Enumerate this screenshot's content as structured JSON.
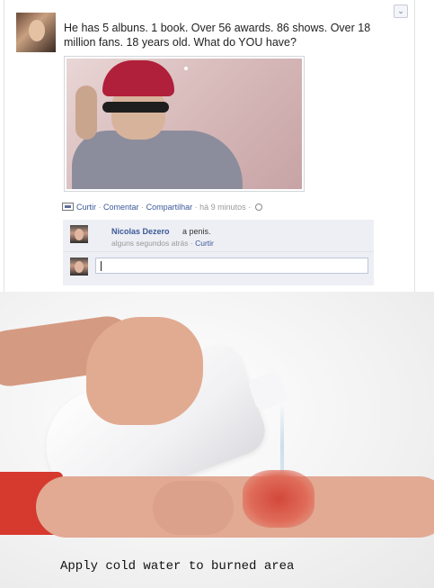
{
  "post": {
    "text": "He has 5 albuns. 1 book. Over 56 awards. 86 shows. Over 18 million fans. 18 years old. What do YOU have?",
    "actions": {
      "like": "Curtir",
      "comment": "Comentar",
      "share": "Compartilhar",
      "time": "há 9 minutos"
    }
  },
  "comment": {
    "author": "Nicolas Dezero",
    "text": "a penis.",
    "time": "alguns segundos atrás",
    "like": "Curtir"
  },
  "caption": "Apply cold water to burned area",
  "icons": {
    "chevron": "chevron-down-icon",
    "like": "like-icon",
    "privacy": "globe-icon"
  },
  "colors": {
    "link": "#3b5998",
    "comment_bg": "#edeff4"
  }
}
